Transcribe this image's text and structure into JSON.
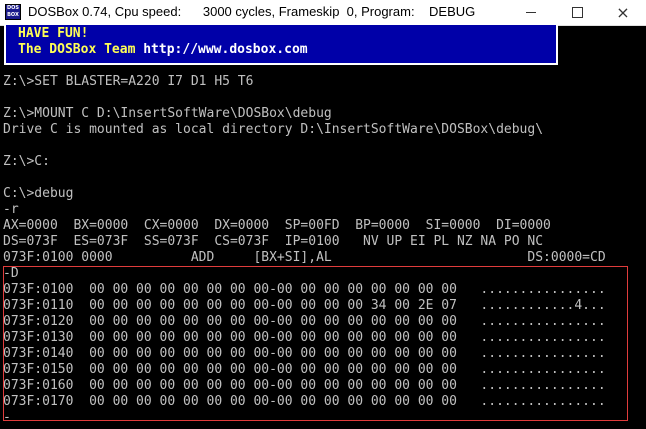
{
  "window": {
    "title": "DOSBox 0.74, Cpu speed:      3000 cycles, Frameskip  0, Program:    DEBUG",
    "icon_text": "DOS BOX",
    "controls": {
      "minimize": "minimize-icon",
      "maximize": "maximize-icon",
      "close": "×"
    }
  },
  "banner": {
    "line1": "HAVE FUN!",
    "line2_prefix": "The DOSBox Team ",
    "line2_url": "http://www.dosbox.com"
  },
  "terminal": {
    "lines": [
      "Z:\\>SET BLASTER=A220 I7 D1 H5 T6",
      "",
      "Z:\\>MOUNT C D:\\InsertSoftWare\\DOSBox\\debug",
      "Drive C is mounted as local directory D:\\InsertSoftWare\\DOSBox\\debug\\",
      "",
      "Z:\\>C:",
      "",
      "C:\\>debug",
      "-r",
      "AX=0000  BX=0000  CX=0000  DX=0000  SP=00FD  BP=0000  SI=0000  DI=0000",
      "DS=073F  ES=073F  SS=073F  CS=073F  IP=0100   NV UP EI PL NZ NA PO NC",
      "073F:0100 0000          ADD     [BX+SI],AL                         DS:0000=CD",
      "-D",
      "073F:0100  00 00 00 00 00 00 00 00-00 00 00 00 00 00 00 00   ................",
      "073F:0110  00 00 00 00 00 00 00 00-00 00 00 00 34 00 2E 07   ............4...",
      "073F:0120  00 00 00 00 00 00 00 00-00 00 00 00 00 00 00 00   ................",
      "073F:0130  00 00 00 00 00 00 00 00-00 00 00 00 00 00 00 00   ................",
      "073F:0140  00 00 00 00 00 00 00 00-00 00 00 00 00 00 00 00   ................",
      "073F:0150  00 00 00 00 00 00 00 00-00 00 00 00 00 00 00 00   ................",
      "073F:0160  00 00 00 00 00 00 00 00-00 00 00 00 00 00 00 00   ................",
      "073F:0170  00 00 00 00 00 00 00 00-00 00 00 00 00 00 00 00   ................",
      "-"
    ]
  },
  "colors": {
    "terminal_bg": "#000000",
    "terminal_fg": "#c0c0c0",
    "banner_bg": "#0000a8",
    "banner_fg": "#ffff55",
    "highlight_border": "#e03c3c"
  }
}
